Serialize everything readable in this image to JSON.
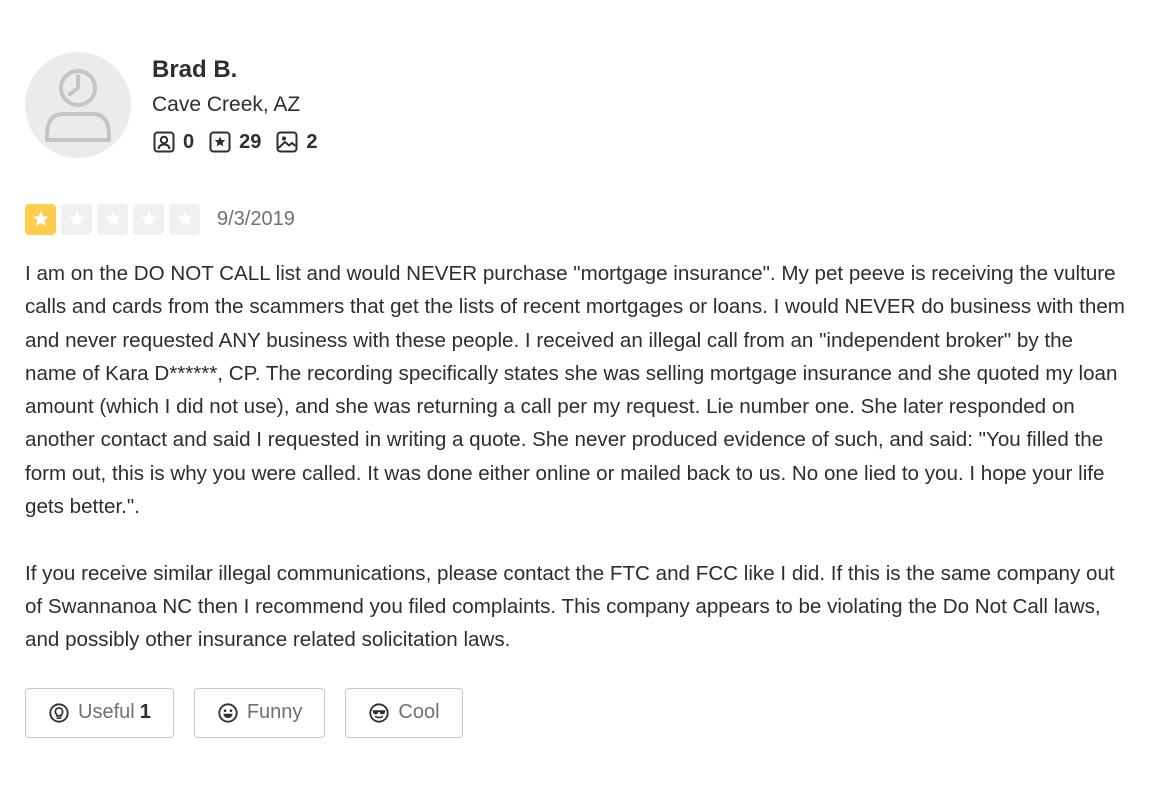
{
  "user": {
    "name": "Brad B.",
    "location": "Cave Creek, AZ",
    "stats": {
      "friends": "0",
      "reviews": "29",
      "photos": "2"
    }
  },
  "review": {
    "rating": 1,
    "rating_max": 5,
    "date": "9/3/2019",
    "paragraphs": [
      "I am on the DO NOT CALL list and would NEVER purchase \"mortgage insurance\". My pet peeve is receiving the vulture calls and cards from the scammers that get the lists of recent mortgages or loans.  I would NEVER do business with them and never requested ANY business with these people.  I received an illegal call from an \"independent broker\" by the name of Kara D******, CP. The recording specifically states she was selling mortgage insurance and she quoted my loan amount (which I did not use), and she was returning a call per my request.  Lie number one.  She later responded on another contact and said I requested in writing a quote. She never produced evidence of such, and said: \"You filled the form out, this is why you were called. It was done either online or mailed back to us. No one lied to you. I hope your life gets better.\".",
      "If you receive similar illegal communications, please contact the FTC and FCC like I did.  If this is the same company out of Swannanoa NC then I recommend you filed complaints.  This company appears to be violating the Do Not Call laws, and possibly other insurance related solicitation laws."
    ]
  },
  "reactions": {
    "useful_label": "Useful",
    "useful_count": "1",
    "funny_label": "Funny",
    "cool_label": "Cool"
  },
  "colors": {
    "star_filled": "#ffcc4b",
    "star_empty": "#f0f0f0",
    "text": "#2d2e2f",
    "muted": "#6e7072",
    "border": "#c8c9ca"
  },
  "icons": {
    "friends": "friends-icon",
    "reviews": "review-star-icon",
    "photos": "photo-icon",
    "useful": "lightbulb-icon",
    "funny": "smiley-icon",
    "cool": "sunglasses-icon"
  }
}
